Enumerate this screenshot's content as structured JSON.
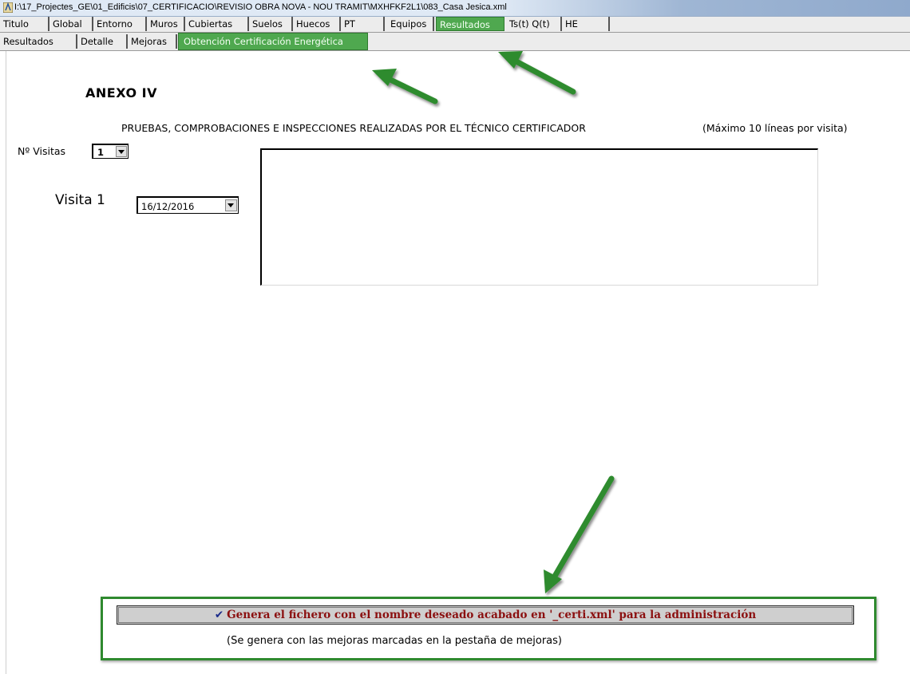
{
  "window": {
    "title": "I:\\17_Projectes_GE\\01_Edificis\\07_CERTIFICACIO\\REVISIO OBRA NOVA - NOU TRAMIT\\MXHFKF2L1\\083_Casa Jesica.xml"
  },
  "main_tabs": [
    {
      "label": "Titulo",
      "active": false
    },
    {
      "label": "Global",
      "active": false
    },
    {
      "label": "Entorno",
      "active": false
    },
    {
      "label": "Muros",
      "active": false
    },
    {
      "label": "Cubiertas",
      "active": false
    },
    {
      "label": "Suelos",
      "active": false
    },
    {
      "label": "Huecos",
      "active": false
    },
    {
      "label": "PT",
      "active": false
    },
    {
      "label": "Equipos",
      "active": false
    },
    {
      "label": "Resultados",
      "active": true
    },
    {
      "label": "Ts(t) Q(t)",
      "active": false
    },
    {
      "label": "HE",
      "active": false
    }
  ],
  "sub_tabs": [
    {
      "label": "Resultados",
      "active": false
    },
    {
      "label": "Detalle",
      "active": false
    },
    {
      "label": "Mejoras",
      "active": false
    },
    {
      "label": "Obtención Certificación Energética",
      "active": true
    }
  ],
  "annex": {
    "title": "ANEXO  IV",
    "heading": "PRUEBAS, COMPROBACIONES E INSPECCIONES REALIZADAS POR EL TÉCNICO CERTIFICADOR",
    "max_note": "(Máximo 10 líneas por visita)",
    "visits_label": "Nº Visitas",
    "visits_value": "1",
    "visit_label": "Visita 1",
    "visit_date": "16/12/2016",
    "visit_notes": ""
  },
  "generate": {
    "button_label": "Genera el fichero con el nombre deseado acabado en '_certi.xml' para la administración",
    "note": "(Se genera con las mejoras marcadas en la pestaña de mejoras)"
  },
  "colors": {
    "active_tab": "#4fa84f",
    "highlight_border": "#2f8a2f",
    "arrow": "#2e8b2e",
    "button_text": "#8b1010"
  }
}
